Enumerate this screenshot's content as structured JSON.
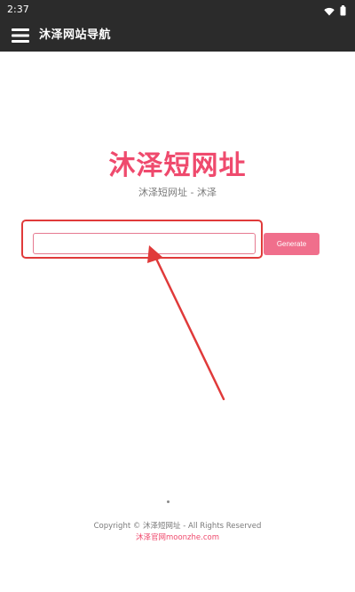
{
  "status_bar": {
    "time": "2:37",
    "icons": [
      "wifi-icon",
      "battery-icon"
    ]
  },
  "app_bar": {
    "menu_icon": "hamburger-menu-icon",
    "title": "沐泽网站导航"
  },
  "hero": {
    "title": "沐泽短网址",
    "subtitle": "沐泽短网址 - 沐泽"
  },
  "form": {
    "url_input_value": "",
    "url_input_placeholder": "",
    "generate_label": "Generate"
  },
  "footer": {
    "copyright": "Copyright © 沐泽短网址 - All Rights Reserved",
    "link_text": "沐泽官网moonzhe.com"
  },
  "colors": {
    "bar_background": "#2b2b2b",
    "accent": "#ef4a6d",
    "button": "#f06f8c",
    "annotation_red": "#e03a3a"
  }
}
